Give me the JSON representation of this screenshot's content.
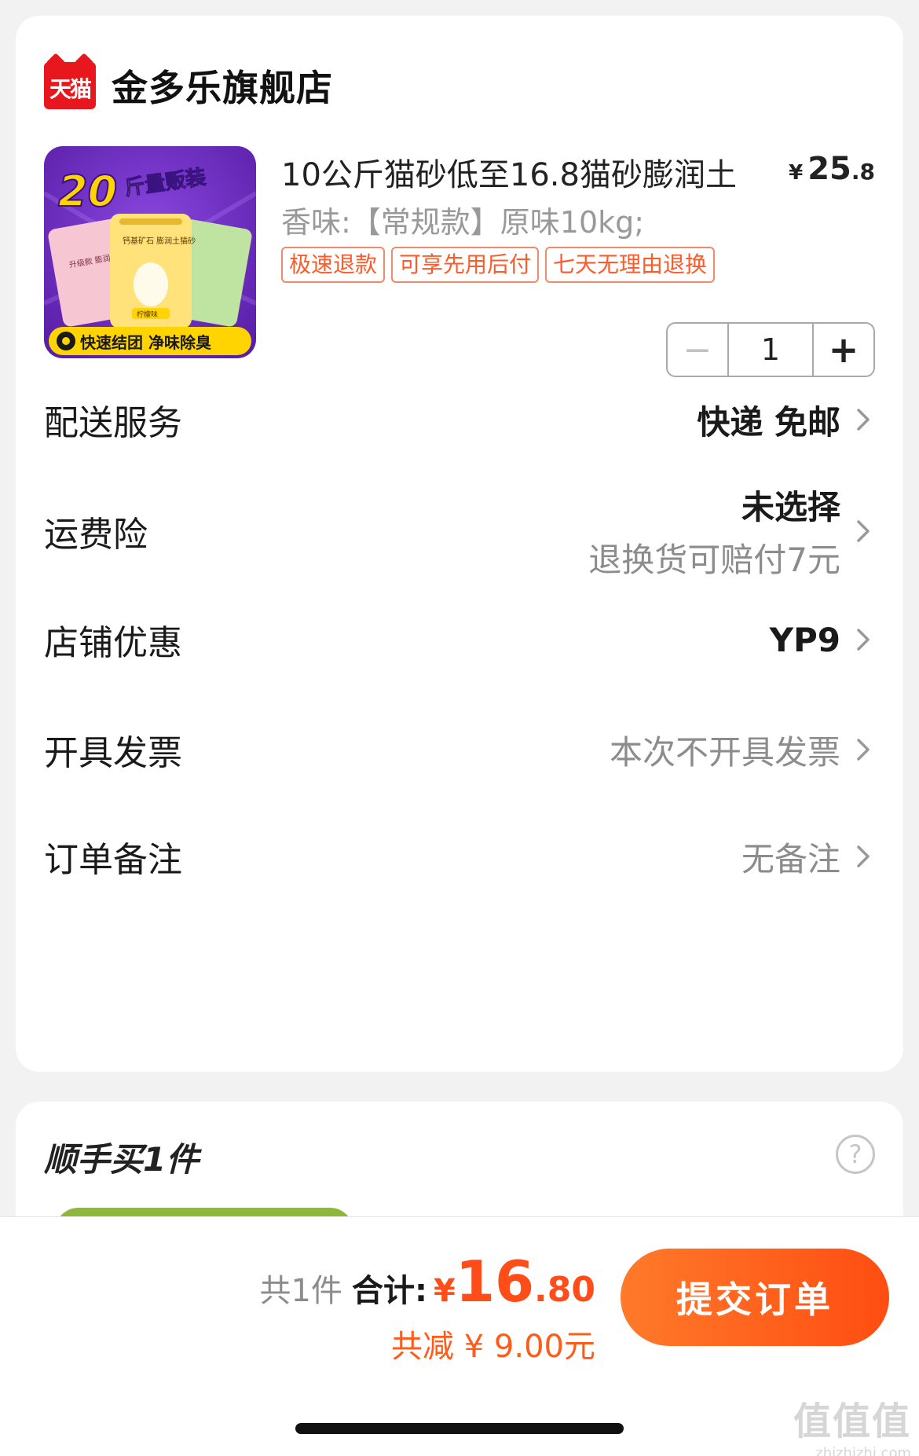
{
  "store": {
    "logo_text": "天猫",
    "name": "金多乐旗舰店"
  },
  "product": {
    "title": "10公斤猫砂低至16.8猫砂膨润土",
    "price_symbol": "¥",
    "price_int": "25",
    "price_dec": ".8",
    "spec": "香味:【常规款】原味10kg;",
    "tags": [
      "极速退款",
      "可享先用后付",
      "七天无理由退换"
    ],
    "quantity": "1",
    "image_texts": {
      "banner": "20斤量贩装",
      "footer": "快速结团 净味除臭",
      "bag_left": "升级款 膨润土猫砂",
      "bag_center": "钙基矿石 膨润土猫砂",
      "bag_center_label": "柠檬味"
    }
  },
  "rows": {
    "delivery": {
      "label": "配送服务",
      "value": "快递 免邮"
    },
    "insurance": {
      "label": "运费险",
      "value": "未选择",
      "sub": "退换货可赔付7元"
    },
    "coupon": {
      "label": "店铺优惠",
      "value": "YP9"
    },
    "invoice": {
      "label": "开具发票",
      "value": "本次不开具发票"
    },
    "remark": {
      "label": "订单备注",
      "value": "无备注"
    }
  },
  "addon": {
    "title": "顺手买1件",
    "help_icon": "question-circle-icon"
  },
  "summary": {
    "count_label": "共1件",
    "total_label": "合计:",
    "total_symbol": "¥",
    "total_int": "16",
    "total_dec": ".80",
    "saved": "共减 ¥ 9.00元",
    "submit": "提交订单"
  },
  "watermark": {
    "main": "值值值",
    "sub": "zhizhizhi.com"
  },
  "colors": {
    "accent": "#ff4d1a",
    "tag_border": "#f08a6b",
    "tmall_red": "#e8161d",
    "image_bg": "#6a2fb8"
  }
}
